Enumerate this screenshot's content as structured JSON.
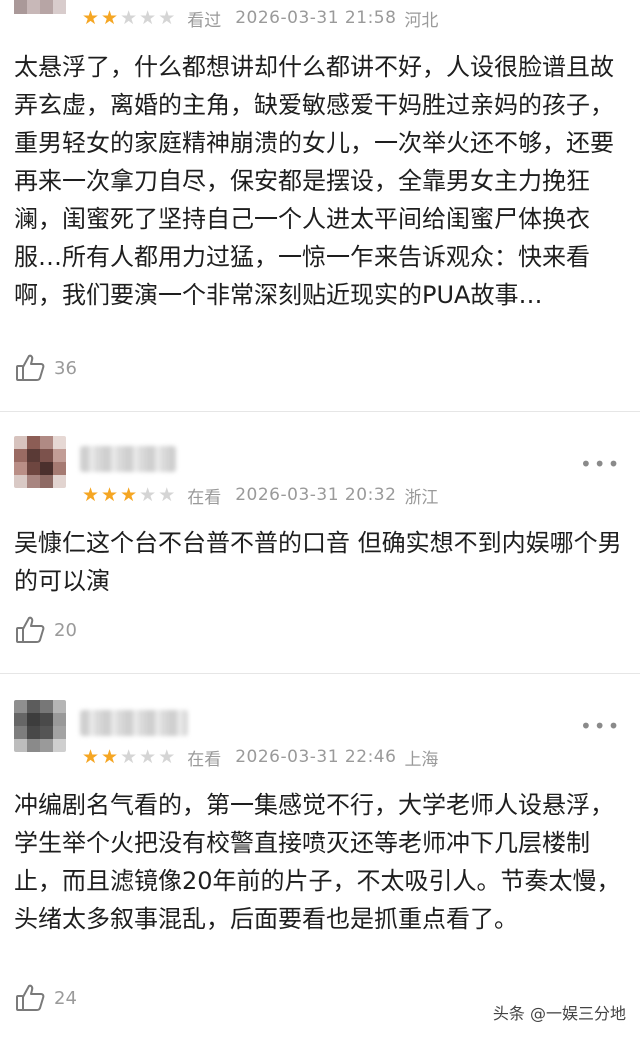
{
  "reviews": [
    {
      "status": "看过",
      "time": "2026-03-31 21:58",
      "location": "河北",
      "rating": 2,
      "text": "太悬浮了，什么都想讲却什么都讲不好，人设很脸谱且故弄玄虚，离婚的主角，缺爱敏感爱干妈胜过亲妈的孩子，重男轻女的家庭精神崩溃的女儿，一次举火还不够，还要再来一次拿刀自尽，保安都是摆设，全靠男女主力挽狂澜，闺蜜死了坚持自己一个人进太平间给闺蜜尸体换衣服…所有人都用力过猛，一惊一乍来告诉观众：快来看啊，我们要演一个非常深刻贴近现实的PUA故事…",
      "likes": "36"
    },
    {
      "status": "在看",
      "time": "2026-03-31 20:32",
      "location": "浙江",
      "rating": 3,
      "text": "吴慷仁这个台不台普不普的口音 但确实想不到内娱哪个男的可以演",
      "likes": "20"
    },
    {
      "status": "在看",
      "time": "2026-03-31 22:46",
      "location": "上海",
      "rating": 2,
      "text": "冲编剧名气看的，第一集感觉不行，大学老师人设悬浮，学生举个火把没有校警直接喷灭还等老师冲下几层楼制止，而且滤镜像20年前的片子，不太吸引人。节奏太慢，头绪太多叙事混乱，后面要看也是抓重点看了。",
      "likes": "24"
    }
  ],
  "watermark": "头条 @一娱三分地",
  "icons": {
    "like": "thumbs-up-icon",
    "more": "more-dots-icon",
    "star": "star-icon"
  },
  "colors": {
    "star_on": "#f5a623",
    "star_off": "#d5d5d5",
    "meta": "#9a9a9a"
  }
}
